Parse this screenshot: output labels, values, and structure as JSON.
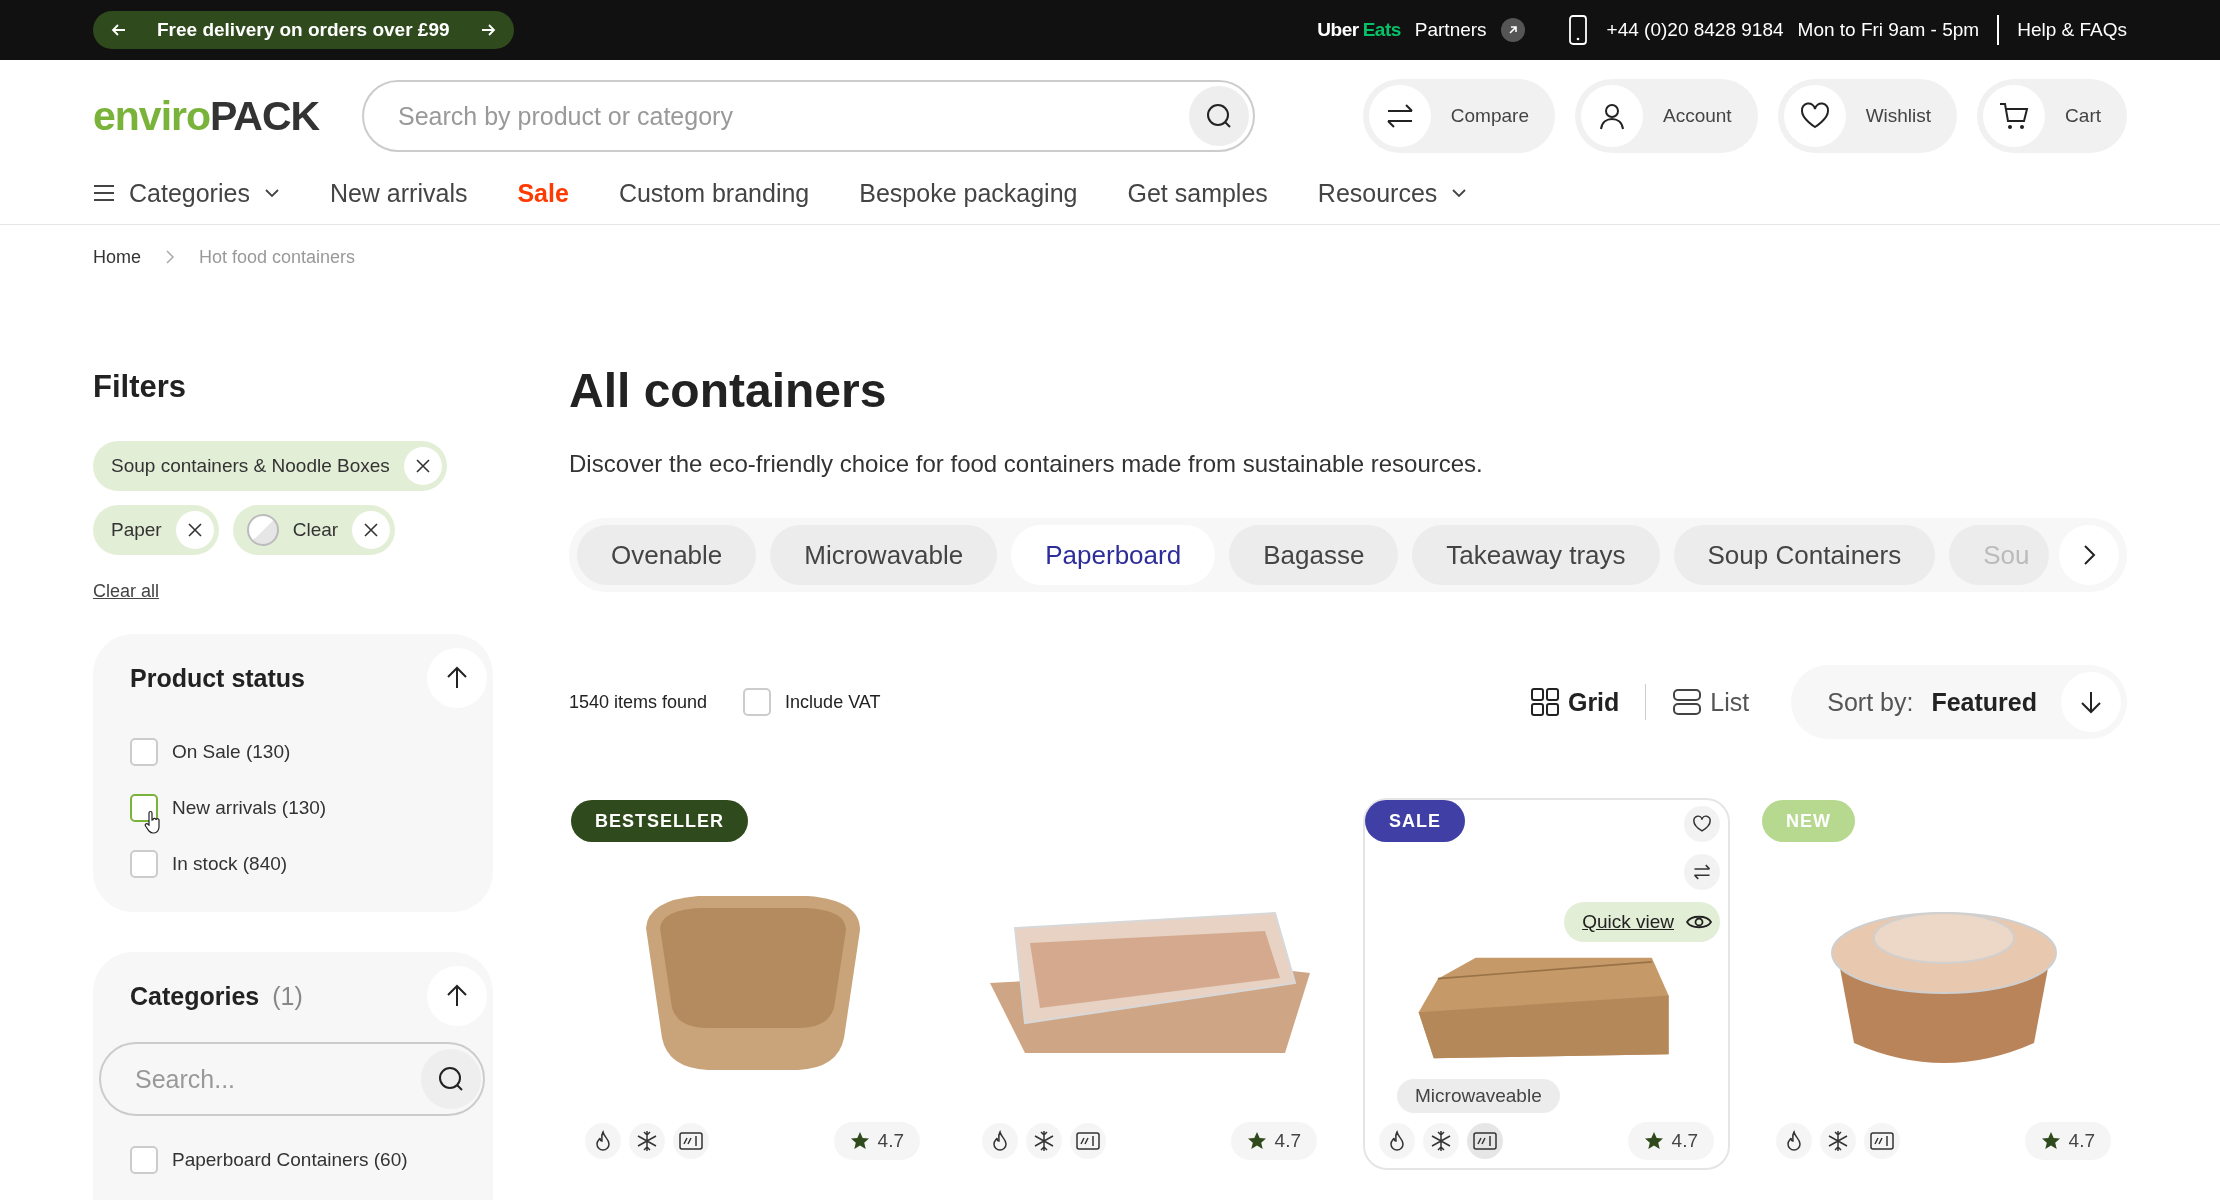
{
  "promo_bar": {
    "text": "Free delivery on orders over £99"
  },
  "top_links": {
    "partner_brand": "Uber",
    "partner_brand_accent": "Eats",
    "partner_label": "Partners",
    "phone": "+44 (0)20 8428 9184",
    "hours": "Mon to Fri 9am - 5pm",
    "help": "Help & FAQs"
  },
  "logo": {
    "part_1": "enviro",
    "part_2": "PACK"
  },
  "search": {
    "placeholder": "Search by product or category"
  },
  "header_actions": [
    {
      "label": "Compare",
      "kind": "compare"
    },
    {
      "label": "Account",
      "kind": "account"
    },
    {
      "label": "Wishlist",
      "kind": "wishlist"
    },
    {
      "label": "Cart",
      "kind": "cart"
    }
  ],
  "nav": [
    {
      "label": "Categories",
      "kind": "menu"
    },
    {
      "label": "New arrivals",
      "kind": "link"
    },
    {
      "label": "Sale",
      "kind": "sale"
    },
    {
      "label": "Custom branding",
      "kind": "link"
    },
    {
      "label": "Bespoke packaging",
      "kind": "link"
    },
    {
      "label": "Get samples",
      "kind": "link"
    },
    {
      "label": "Resources",
      "kind": "dropdown"
    }
  ],
  "breadcrumb": [
    "Home",
    "Hot food containers"
  ],
  "filters": {
    "title": "Filters",
    "active": [
      {
        "label": "Soup containers & Noodle Boxes",
        "kind": "text"
      },
      {
        "label": "Paper",
        "kind": "text"
      },
      {
        "label": "Clear",
        "kind": "swatch"
      }
    ],
    "clear_all": "Clear all"
  },
  "product_status": {
    "title": "Product status",
    "expanded": true,
    "options": [
      {
        "label": "On Sale",
        "count": "(130)",
        "checked": false,
        "hovered": false
      },
      {
        "label": "New arrivals",
        "count": "(130)",
        "checked": false,
        "hovered": true
      },
      {
        "label": "In stock",
        "count": "(840)",
        "checked": false,
        "hovered": false
      }
    ]
  },
  "categories": {
    "title": "Categories",
    "count": "(1)",
    "expanded": true,
    "search_placeholder": "Search...",
    "options": [
      {
        "label": "Paperboard Containers",
        "count": "(60)",
        "checked": false
      }
    ]
  },
  "page": {
    "title": "All containers",
    "description": "Discover the eco-friendly choice for food containers made from sustainable resources."
  },
  "category_tabs": [
    {
      "label": "Ovenable",
      "selected": false
    },
    {
      "label": "Microwavable",
      "selected": false
    },
    {
      "label": "Paperboard",
      "selected": true
    },
    {
      "label": "Bagasse",
      "selected": false
    },
    {
      "label": "Takeaway trays",
      "selected": false
    },
    {
      "label": "Soup Containers",
      "selected": false
    },
    {
      "label": "Sou",
      "selected": false
    }
  ],
  "results": {
    "count": "1540 items found",
    "include_vat": {
      "label": "Include VAT",
      "checked": false
    }
  },
  "views": [
    {
      "label": "Grid",
      "kind": "grid",
      "selected": true
    },
    {
      "label": "List",
      "kind": "list",
      "selected": false
    }
  ],
  "sort": {
    "label": "Sort by:",
    "value": "Featured"
  },
  "products": [
    {
      "badge": {
        "label": "BESTSELLER",
        "color": "#2f4a1c"
      },
      "kind": "square-bowl",
      "rating": "4.7",
      "hovered": false
    },
    {
      "kind": "tray",
      "rating": "4.7",
      "hovered": false
    },
    {
      "badge": {
        "label": "SALE",
        "color": "#3f3fa6"
      },
      "kind": "box",
      "rating": "4.7",
      "hovered": true,
      "quick_view": "Quick view",
      "tooltip": "Microwaveable"
    },
    {
      "badge": {
        "label": "NEW",
        "color": "#b6d98f"
      },
      "kind": "round-bowl",
      "rating": "4.7",
      "hovered": false
    }
  ]
}
